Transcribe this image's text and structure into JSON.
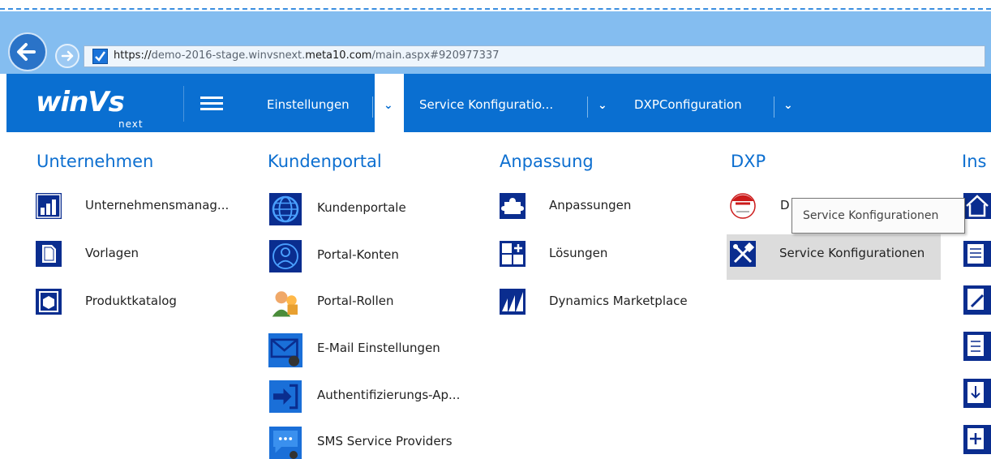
{
  "browser": {
    "url_scheme": "https://",
    "url_pre": "demo-2016-stage.winvsnext.",
    "url_host": "meta10.com",
    "url_path": "/main.aspx#920977337"
  },
  "logo": {
    "word": "winVs",
    "sub": "next"
  },
  "nav": {
    "items": [
      {
        "label": "Einstellungen"
      },
      {
        "label": "Service Konfiguratio..."
      },
      {
        "label": "DXPConfiguration"
      }
    ],
    "chevron": "⌄"
  },
  "columns": [
    {
      "title": "Unternehmen",
      "items": [
        {
          "label": "Unternehmensmanag...",
          "icon": "company-management-icon"
        },
        {
          "label": "Vorlagen",
          "icon": "templates-icon"
        },
        {
          "label": "Produktkatalog",
          "icon": "product-catalog-icon"
        }
      ]
    },
    {
      "title": "Kundenportal",
      "items": [
        {
          "label": "Kundenportale",
          "icon": "portal-globe-icon"
        },
        {
          "label": "Portal-Konten",
          "icon": "portal-account-icon"
        },
        {
          "label": "Portal-Rollen",
          "icon": "portal-roles-icon"
        },
        {
          "label": "E-Mail Einstellungen",
          "icon": "email-settings-icon"
        },
        {
          "label": "Authentifizierungs-Ap...",
          "icon": "authentication-icon"
        },
        {
          "label": "SMS Service Providers",
          "icon": "sms-icon"
        }
      ]
    },
    {
      "title": "Anpassung",
      "items": [
        {
          "label": "Anpassungen",
          "icon": "puzzle-icon"
        },
        {
          "label": "Lösungen",
          "icon": "solutions-icon"
        },
        {
          "label": "Dynamics Marketplace",
          "icon": "marketplace-icon"
        }
      ]
    },
    {
      "title": "DXP",
      "items": [
        {
          "label": "D",
          "icon": "igb2b-icon"
        },
        {
          "label": "Service Konfigurationen",
          "icon": "tools-icon"
        }
      ]
    },
    {
      "title": "Ins",
      "items": []
    }
  ],
  "tooltip": {
    "text": "Service Konfigurationen"
  },
  "colors": {
    "brand": "#0a6fd1",
    "title": "#0d6fd0",
    "icon_bg": "#0a2d8f"
  }
}
